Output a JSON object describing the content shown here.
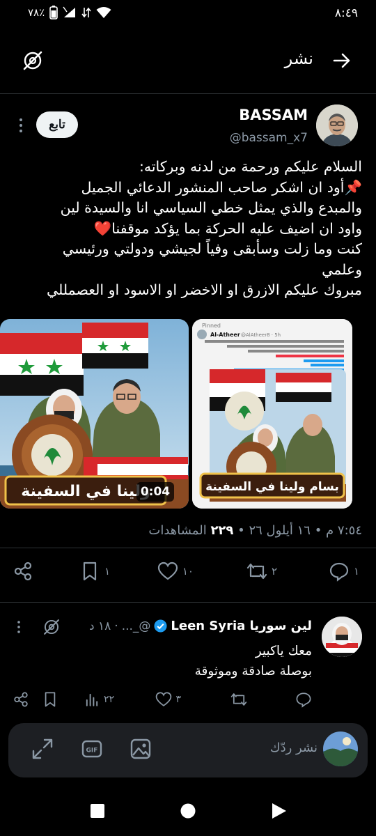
{
  "status": {
    "time": "٨:٤٩",
    "battery": "٧٨٪"
  },
  "header": {
    "title": "نشر"
  },
  "tweet": {
    "author_name": "BASSAM",
    "author_handle": "@bassam_x7",
    "follow_label": "تابع",
    "lines": [
      "السلام عليكم ورحمة من لدنه وبركاته:",
      "📌أود ان اشكر صاحب المنشور الدعائي الجميل",
      "والمبدع  والذي يمثل خطي السياسي انا والسيدة لين",
      "واود ان اضيف عليه   الحركة بما يؤكد موقفنا❤️",
      "كنت وما زلت وسأبقى وفياً لجيشي ودولتي ورئيسي",
      "وعلمي",
      "مبروك عليكم الازرق او الاخضر او الاسود او العصمللي"
    ],
    "media": {
      "video_duration": "0:04",
      "banner_left": "ولينا في السفينة",
      "banner_right": "بسام ولينا في السفينة",
      "inner_header": "Pinned",
      "inner_author": "Al-Atheer",
      "inner_handle": "@AlAtheer8 · 5h"
    },
    "meta_time": "٧:٥٤ م",
    "meta_date": "١٦ أيلول ٢٦",
    "views_count": "٢٢٩",
    "views_label": "المشاهدات"
  },
  "actions": {
    "replies": "١",
    "reposts": "٢",
    "likes": "١٠",
    "bookmarks": "١"
  },
  "reply": {
    "name": "لين سوريا Leen Syria",
    "handle": "@_...",
    "time": "١٨ د",
    "lines": [
      "معك ياكبير",
      "بوصلة صادقة وموثوقة"
    ],
    "likes": "٣",
    "views": "٢٢"
  },
  "composer": {
    "placeholder": "نشر ردّك"
  },
  "colors": {
    "background": "#000000",
    "text": "#e7e9ea",
    "muted": "#8b98a5",
    "verified": "#1d9bf0",
    "like_heart": "#f91880"
  }
}
